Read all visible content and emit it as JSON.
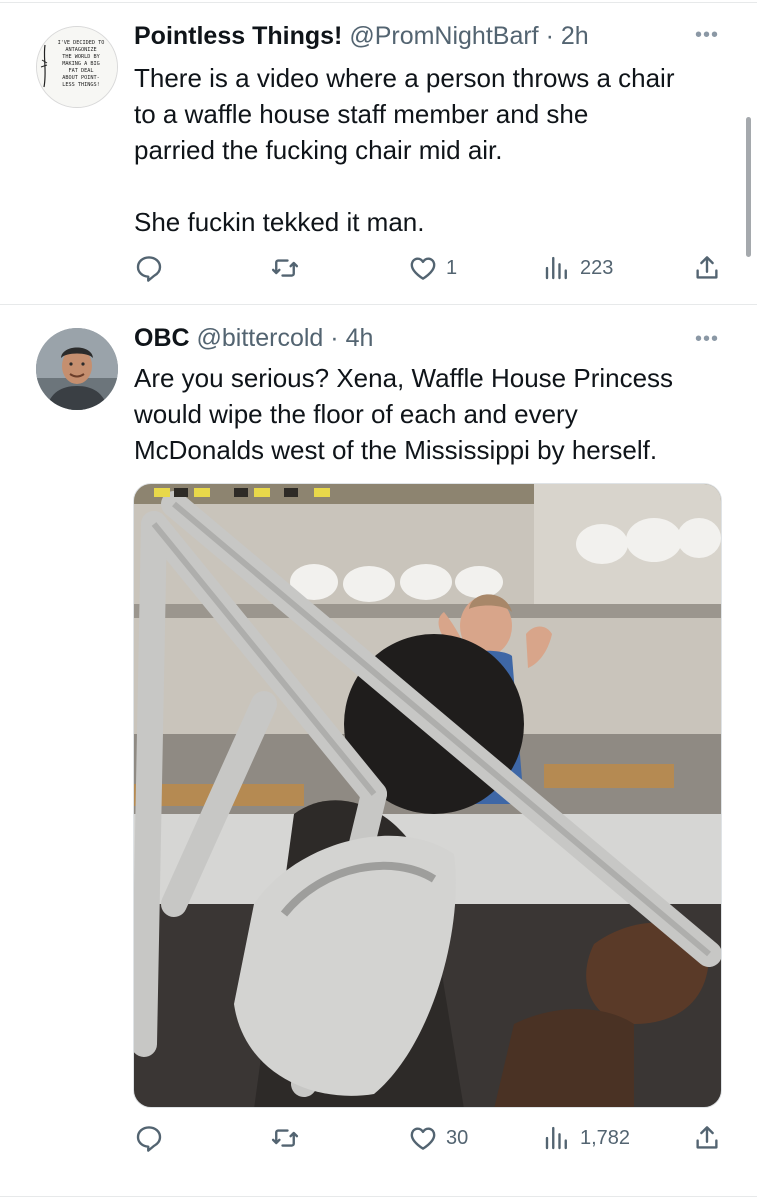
{
  "tweets": [
    {
      "name": "Pointless Things!",
      "handle": "@PromNightBarf",
      "time": "2h",
      "avatar_text": "I'VE DECIDED TO ANTAGONIZE THE WORLD BY MAKING A BIG FAT DEAL ABOUT POINT-LESS THINGS!",
      "lines": [
        "There is a video where a person throws a chair",
        "to a waffle house staff member and she",
        "parried the fucking chair mid air.",
        "",
        "She fuckin tekked it man."
      ],
      "stats": {
        "replies": "",
        "retweets": "",
        "likes": "1",
        "views": "223"
      }
    },
    {
      "name": "OBC",
      "handle": "@bittercold",
      "time": "4h",
      "lines": [
        "Are you serious? Xena, Waffle House Princess",
        "would wipe the floor of each and every",
        "McDonalds west of the Mississippi by herself."
      ],
      "stats": {
        "replies": "",
        "retweets": "",
        "likes": "30",
        "views": "1,782"
      }
    }
  ],
  "more_label": "•••",
  "separator": "·",
  "colors": {
    "text": "#0f1419",
    "secondary": "#536471",
    "divider": "#e7e9ea"
  },
  "icons": [
    "reply-icon",
    "retweet-icon",
    "like-icon",
    "views-icon",
    "share-icon",
    "more-icon"
  ]
}
